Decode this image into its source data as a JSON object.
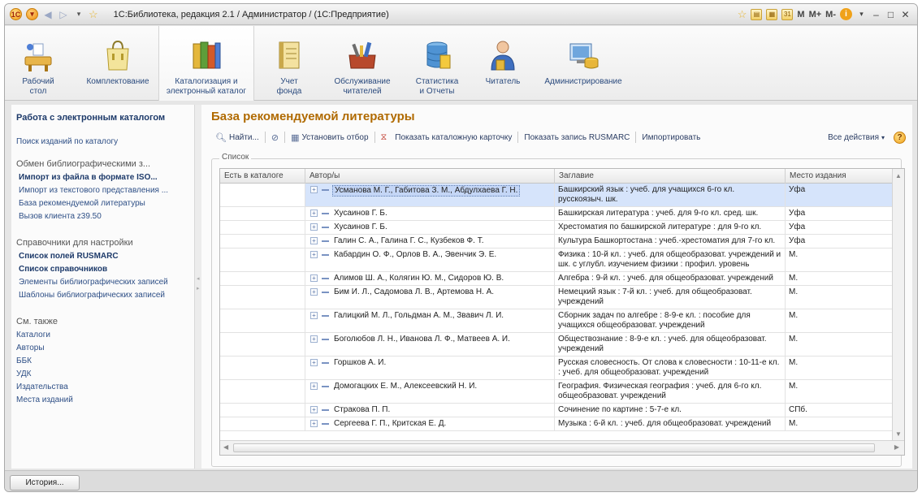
{
  "window": {
    "title": "1С:Библиотека, редакция 2.1 / Администратор /  (1С:Предприятие)",
    "mem_buttons": [
      "M",
      "M+",
      "M-"
    ]
  },
  "sections": [
    {
      "label": "Рабочий стол",
      "icon": "desk-icon",
      "active": false
    },
    {
      "label": "Комплектование",
      "icon": "shopping-bag-icon",
      "active": false
    },
    {
      "label": "Каталогизация и электронный каталог",
      "icon": "books-icon",
      "active": true
    },
    {
      "label": "Учет фонда",
      "icon": "ledger-icon",
      "active": false
    },
    {
      "label": "Обслуживание читателей",
      "icon": "toolbox-icon",
      "active": false
    },
    {
      "label": "Статистика и Отчеты",
      "icon": "database-icon",
      "active": false
    },
    {
      "label": "Читатель",
      "icon": "person-icon",
      "active": false
    },
    {
      "label": "Администрирование",
      "icon": "computer-icon",
      "active": false
    }
  ],
  "leftnav": {
    "head": "Работа с электронным каталогом",
    "search": "Поиск изданий по каталогу",
    "exchange_title": "Обмен библиографическими з...",
    "exchange_items": [
      {
        "label": "Импорт из файла в формате ISO...",
        "bold": true
      },
      {
        "label": "Импорт из текстового представления ...",
        "bold": false
      },
      {
        "label": "База рекомендуемой литературы",
        "bold": false
      },
      {
        "label": "Вызов клиента z39.50",
        "bold": false
      }
    ],
    "settings_title": "Справочники для настройки",
    "settings_items": [
      {
        "label": "Список полей RUSMARC",
        "bold": true
      },
      {
        "label": "Список справочников",
        "bold": true
      },
      {
        "label": "Элементы библиографических записей",
        "bold": false
      },
      {
        "label": "Шаблоны библиографических записей",
        "bold": false
      }
    ],
    "see_also_title": "См. также",
    "see_also_items": [
      "Каталоги",
      "Авторы",
      "ББК",
      "УДК",
      "Издательства",
      "Места изданий"
    ]
  },
  "main": {
    "title": "База рекомендуемой литературы",
    "toolbar": {
      "find": "Найти...",
      "set_filter": "Установить отбор",
      "show_card": "Показать каталожную карточку",
      "show_rusmarc": "Показать запись RUSMARC",
      "import": "Импортировать",
      "all_actions": "Все действия",
      "help": "?"
    },
    "group_title": "Список",
    "columns": [
      "Есть в каталоге",
      "Автор/ы",
      "Заглавие",
      "Место издания"
    ],
    "rows": [
      {
        "author": "Усманова М. Г., Габитова З. М., Абдулхаева Г. Н.",
        "title": "Башкирский язык : учеб. для учащихся 6-го кл. русскоязыч. шк.",
        "place": "Уфа",
        "selected": true
      },
      {
        "author": "Хусаинов Г. Б.",
        "title": "Башкирская литература : учеб. для 9-го кл. сред. шк.",
        "place": "Уфа",
        "selected": false
      },
      {
        "author": "Хусаинов Г. Б.",
        "title": "Хрестоматия по башкирской литературе : для 9-го кл.",
        "place": "Уфа",
        "selected": false
      },
      {
        "author": "Галин С. А., Галина Г. С., Кузбеков Ф. Т.",
        "title": "Культура Башкортостана : учеб.-хрестоматия для 7-го кл.",
        "place": "Уфа",
        "selected": false
      },
      {
        "author": "Кабардин О. Ф., Орлов В. А., Эвенчик Э. Е.",
        "title": "Физика : 10-й кл. : учеб. для общеобразоват. учреждений и шк. с углубл. изучением физики : профил. уровень",
        "place": "М.",
        "selected": false
      },
      {
        "author": "Алимов Ш. А., Колягин Ю. М., Сидоров Ю. В.",
        "title": "Алгебра : 9-й кл. : учеб. для общеобразоват. учреждений",
        "place": "М.",
        "selected": false
      },
      {
        "author": "Бим И. Л., Садомова Л. В., Артемова Н. А.",
        "title": "Немецкий язык : 7-й кл. : учеб. для общеобразоват. учреждений",
        "place": "М.",
        "selected": false
      },
      {
        "author": "Галицкий М. Л., Гольдман А. М., Звавич Л. И.",
        "title": "Сборник задач по алгебре : 8-9-е кл. : пособие для учащихся общеобразоват. учреждений",
        "place": "М.",
        "selected": false
      },
      {
        "author": "Боголюбов Л. Н., Иванова Л. Ф., Матвеев А. И.",
        "title": "Обществознание : 8-9-е кл. : учеб. для общеобразоват. учреждений",
        "place": "М.",
        "selected": false
      },
      {
        "author": "Горшков А. И.",
        "title": "Русская словесность. От слова к словесности : 10-11-е кл. : учеб. для общеобразоват. учреждений",
        "place": "М.",
        "selected": false
      },
      {
        "author": "Домогацких Е. М., Алексеевский Н. И.",
        "title": "География. Физическая география : учеб. для 6-го кл. общеобразоват. учреждений",
        "place": "М.",
        "selected": false
      },
      {
        "author": "Стракова П. П.",
        "title": "Сочинение по картине : 5-7-е кл.",
        "place": "СПб.",
        "selected": false
      },
      {
        "author": "Сергеева Г. П., Критская Е. Д.",
        "title": "Музыка : 6-й кл. : учеб. для общеобразоват. учреждений",
        "place": "М.",
        "selected": false
      }
    ]
  },
  "bottom": {
    "history": "История..."
  }
}
